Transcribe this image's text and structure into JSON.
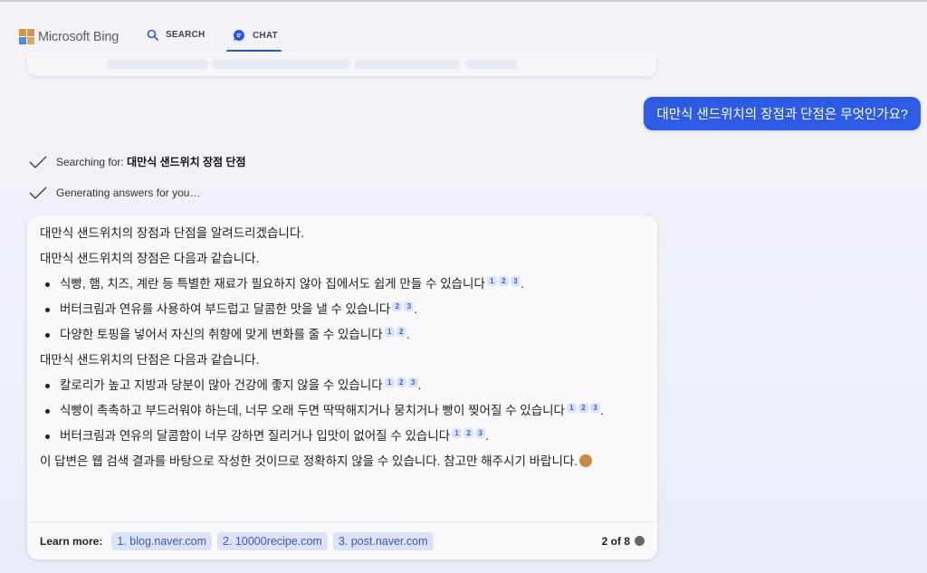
{
  "header": {
    "brand": "Microsoft Bing",
    "tabs": [
      {
        "label": "SEARCH",
        "icon": "search-icon",
        "active": false
      },
      {
        "label": "CHAT",
        "icon": "chat-icon",
        "active": true
      }
    ]
  },
  "user_message": "대만식 샌드위치의 장점과 단점은 무엇인가요?",
  "status": {
    "searching_prefix": "Searching for:",
    "searching_query": "대만식 샌드위치 장점 단점",
    "generating": "Generating answers for you…"
  },
  "answer": {
    "intro": "대만식 샌드위치의 장점과 단점을 알려드리겠습니다.",
    "pros_heading": "대만식 샌드위치의 장점은 다음과 같습니다.",
    "pros": [
      {
        "text": "식빵, 햄, 치즈, 계란 등 특별한 재료가 필요하지 않아 집에서도 쉽게 만들 수 있습니다",
        "cites": [
          "1",
          "2",
          "3"
        ]
      },
      {
        "text": "버터크림과 연유를 사용하여 부드럽고 달콤한 맛을 낼 수 있습니다",
        "cites": [
          "2",
          "3"
        ]
      },
      {
        "text": "다양한 토핑을 넣어서 자신의 취향에 맞게 변화를 줄 수 있습니다",
        "cites": [
          "1",
          "2"
        ]
      }
    ],
    "cons_heading": "대만식 샌드위치의 단점은 다음과 같습니다.",
    "cons": [
      {
        "text": "칼로리가 높고 지방과 당분이 많아 건강에 좋지 않을 수 있습니다",
        "cites": [
          "1",
          "2",
          "3"
        ]
      },
      {
        "text": "식빵이 촉촉하고 부드러워야 하는데, 너무 오래 두면 딱딱해지거나 뭉치거나 빵이 찢어질 수 있습니다",
        "cites": [
          "1",
          "2",
          "3"
        ]
      },
      {
        "text": "버터크림과 연유의 달콤함이 너무 강하면 질리거나 입맛이 없어질 수 있습니다",
        "cites": [
          "1",
          "2",
          "3"
        ]
      }
    ],
    "disclaimer": "이 답변은 웹 검색 결과를 바탕으로 작성한 것이므로 정확하지 않을 수 있습니다. 참고만 해주시기 바랍니다.",
    "emoji": "smiling-face"
  },
  "learn_more": {
    "label": "Learn more:",
    "sources": [
      "1. blog.naver.com",
      "2. 10000recipe.com",
      "3. post.naver.com"
    ],
    "page_count": "2 of 8"
  },
  "colors": {
    "accent": "#2d5be3",
    "cite_bg": "#dbe3fb",
    "chip_bg": "#dde3f7"
  }
}
